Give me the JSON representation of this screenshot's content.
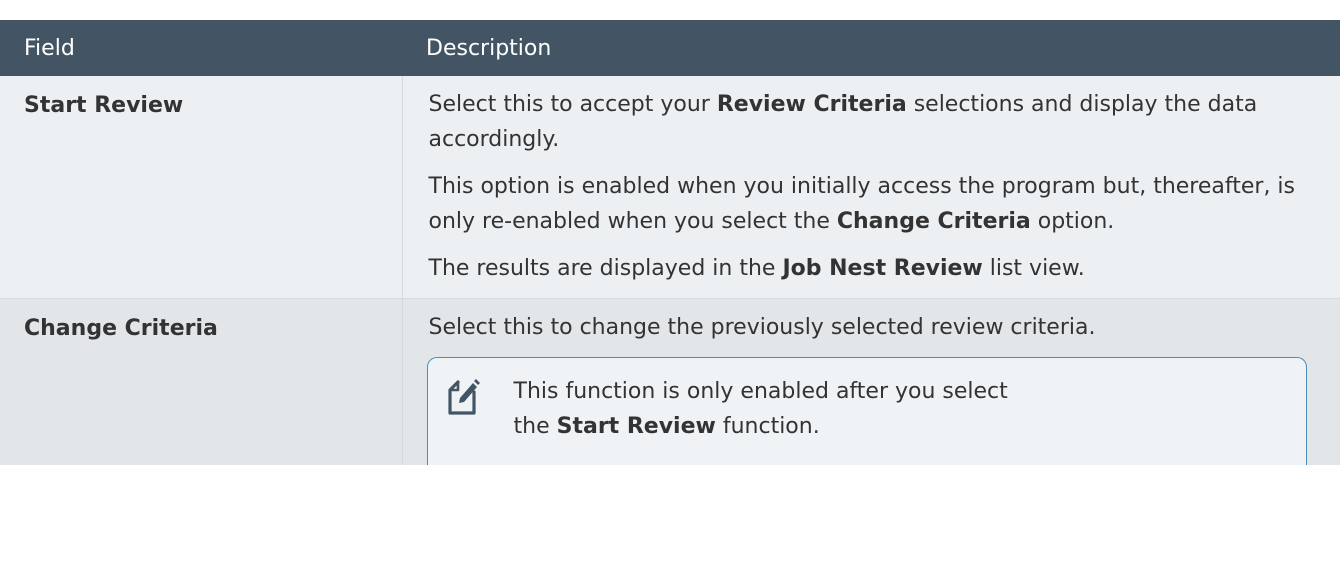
{
  "table": {
    "headers": {
      "field": "Field",
      "description": "Description"
    },
    "rows": [
      {
        "field": "Start Review",
        "p1": {
          "t1": "Select this to accept your ",
          "b1": "Review Criteria",
          "t2": " selections and display the data accordingly."
        },
        "p2": {
          "t1": "This option is enabled when you initially access the program but, thereafter, is only re-enabled when you select the ",
          "b1": "Change Criteria",
          "t2": " option."
        },
        "p3": {
          "t1": "The results are displayed in the ",
          "b1": "Job Nest Review",
          "t2": " list view."
        }
      },
      {
        "field": "Change Criteria",
        "p1": {
          "t1": "Select this to change the previously selected review criteria."
        },
        "note": {
          "icon": "note-pencil-icon",
          "t1": "This function is only enabled after you select the ",
          "b1": "Start Review",
          "t2": " function."
        }
      }
    ]
  },
  "colors": {
    "header_bg": "#435564",
    "row_bg": "#edf0f2",
    "row_alt_bg": "#e3e6e9",
    "note_border": "#4a8fb8",
    "icon_color": "#435564"
  }
}
